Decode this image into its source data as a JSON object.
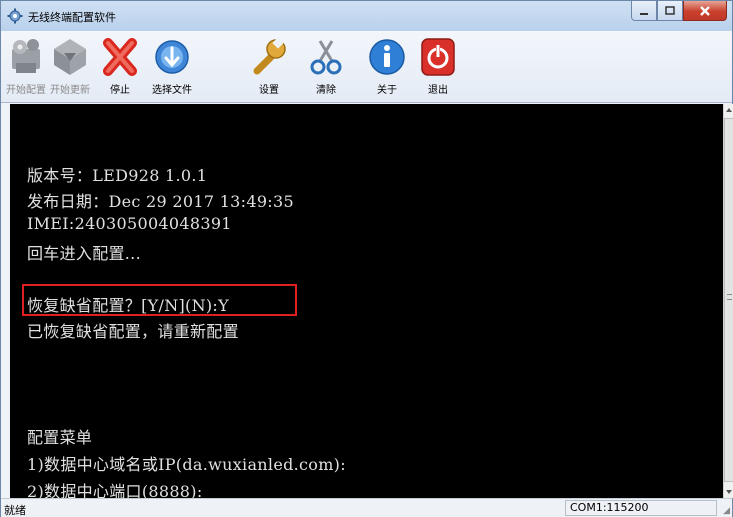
{
  "window": {
    "title": "无线终端配置软件"
  },
  "toolbar": {
    "items": [
      {
        "label": "开始配置",
        "icon": "start-config-icon",
        "enabled": false
      },
      {
        "label": "开始更新",
        "icon": "start-update-icon",
        "enabled": false
      },
      {
        "label": "停止",
        "icon": "stop-icon",
        "enabled": true
      },
      {
        "label": "选择文件",
        "icon": "select-file-icon",
        "enabled": true
      },
      {
        "label": "设置",
        "icon": "settings-icon",
        "enabled": true
      },
      {
        "label": "清除",
        "icon": "clear-icon",
        "enabled": true
      },
      {
        "label": "关于",
        "icon": "about-icon",
        "enabled": true
      },
      {
        "label": "退出",
        "icon": "exit-icon",
        "enabled": true
      }
    ]
  },
  "console": {
    "lines": [
      "版本号：LED928 1.0.1",
      "发布日期：Dec 29 2017 13:49:35",
      "IMEI:240305004048391",
      "回车进入配置...",
      "",
      "恢复缺省配置？[Y/N](N):Y",
      "已恢复缺省配置，请重新配置",
      "",
      "",
      "",
      "配置菜单",
      "1)数据中心域名或IP(da.wuxianled.com):",
      "2)数据中心端口(8888):"
    ]
  },
  "statusbar": {
    "left": "就绪",
    "com": "COM1:115200"
  },
  "colors": {
    "console_bg": "#000000",
    "console_fg": "#e0e0e0",
    "highlight": "#e02020"
  }
}
